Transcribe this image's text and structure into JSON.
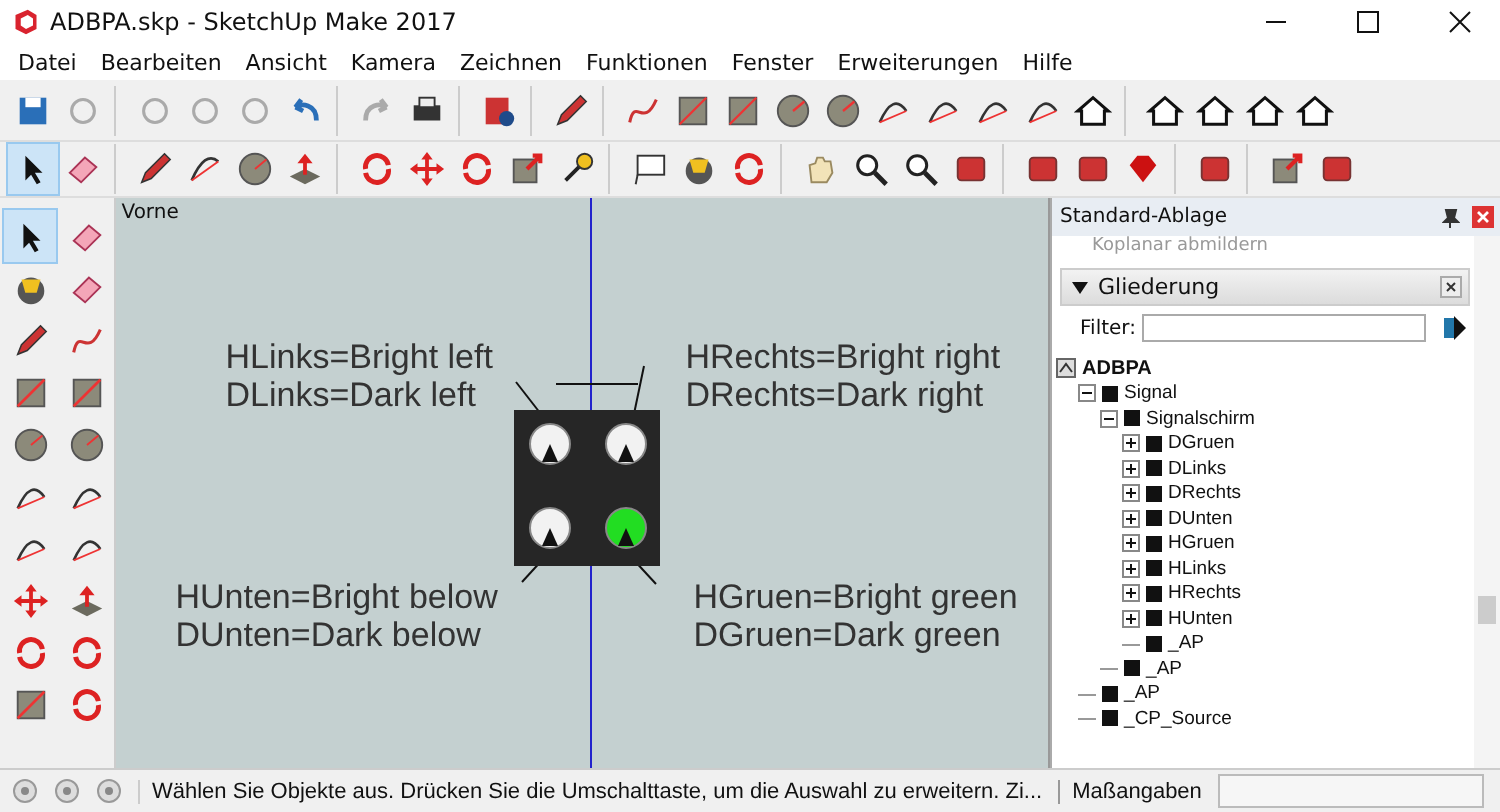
{
  "window": {
    "title": "ADBPA.skp - SketchUp Make 2017"
  },
  "menu": [
    "Datei",
    "Bearbeiten",
    "Ansicht",
    "Kamera",
    "Zeichnen",
    "Funktionen",
    "Fenster",
    "Erweiterungen",
    "Hilfe"
  ],
  "select_tool": {
    "selected": true
  },
  "viewport": {
    "view_label": "Vorne",
    "lamps": [
      {
        "lit": false
      },
      {
        "lit": false
      },
      {
        "lit": false
      },
      {
        "lit": true
      }
    ],
    "annotations": [
      {
        "lines": [
          "HLinks=Bright left",
          "DLinks=Dark left"
        ]
      },
      {
        "lines": [
          "HRechts=Bright right",
          "DRechts=Dark right"
        ]
      },
      {
        "lines": [
          "HUnten=Bright below",
          "DUnten=Dark below"
        ]
      },
      {
        "lines": [
          "HGruen=Bright green",
          "DGruen=Dark green"
        ]
      }
    ]
  },
  "tray": {
    "title": "Standard-Ablage",
    "hidden_row": "Koplanar abmildern",
    "section": {
      "title": "Gliederung",
      "expanded": true
    },
    "filter_label": "Filter:",
    "tree": [
      {
        "label": "ADBPA",
        "children": [
          {
            "label": "Signal",
            "expanded": true,
            "children": [
              {
                "label": "Signalschirm",
                "expanded": true,
                "children": [
                  {
                    "label": "DGruen",
                    "expanded": false
                  },
                  {
                    "label": "DLinks",
                    "expanded": false
                  },
                  {
                    "label": "DRechts",
                    "expanded": false
                  },
                  {
                    "label": "DUnten",
                    "expanded": false
                  },
                  {
                    "label": "HGruen",
                    "expanded": false
                  },
                  {
                    "label": "HLinks",
                    "expanded": false
                  },
                  {
                    "label": "HRechts",
                    "expanded": false
                  },
                  {
                    "label": "HUnten",
                    "expanded": false
                  },
                  {
                    "label": "_AP"
                  }
                ]
              },
              {
                "label": "_AP"
              }
            ]
          },
          {
            "label": "_AP"
          },
          {
            "label": "_CP_Source"
          }
        ]
      }
    ]
  },
  "status_bar": {
    "message": "Wählen Sie Objekte aus. Drücken Sie die Umschalttaste, um die Auswahl zu erweitern. Zi...",
    "measurements_label": "Maßangaben"
  }
}
